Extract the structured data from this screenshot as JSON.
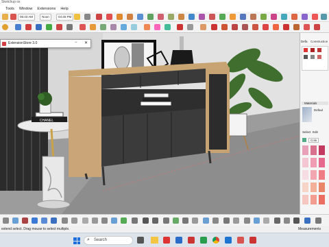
{
  "app": {
    "title": "Sketchup",
    "window_title_suffix": "ox"
  },
  "menus": [
    "Tools",
    "Window",
    "Extensions",
    "Help"
  ],
  "measure_bar": {
    "time1": "05:43 AM",
    "label": "Noon",
    "time2": "04:45 PM"
  },
  "extension_window": {
    "title": "ExtensionStore 3.0"
  },
  "right_panel": {
    "tab_default": "Defa",
    "tab_construction": "Construction",
    "materials_label": "Materials",
    "default_label": "Defaul",
    "select_label": "Select",
    "edit_label": "Edit",
    "color_label": "Colo"
  },
  "scene_text": {
    "book_label": "CHANEL"
  },
  "status": {
    "message": "extend select. Drag mouse to select multiple.",
    "measurements_label": "Measurements"
  },
  "taskbar": {
    "search_placeholder": "Search"
  },
  "swatch_colors": [
    "#e8a1b8",
    "#d9708e",
    "#c43b62",
    "#f4c6d2",
    "#f09cb2",
    "#e66a8d",
    "#f6dde3",
    "#f2a7b0",
    "#ee7d85",
    "#f7d4c8",
    "#f3b19a",
    "#e9866a",
    "#f6c6c0",
    "#f39c90",
    "#ea6f62"
  ]
}
